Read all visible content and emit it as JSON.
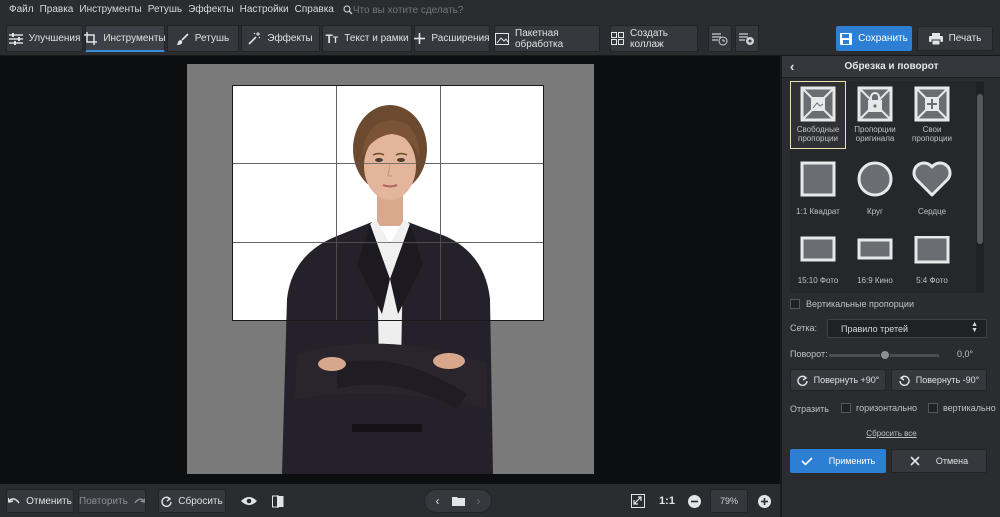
{
  "menu": {
    "items": [
      "Файл",
      "Правка",
      "Инструменты",
      "Ретушь",
      "Эффекты",
      "Настройки",
      "Справка"
    ],
    "search_placeholder": "Что вы хотите сделать?"
  },
  "toolbar": {
    "tabs": [
      {
        "label": "Улучшения",
        "icon": "sliders-icon"
      },
      {
        "label": "Инструменты",
        "icon": "crop-icon",
        "active": true
      },
      {
        "label": "Ретушь",
        "icon": "brush-icon"
      },
      {
        "label": "Эффекты",
        "icon": "magic-wand-icon"
      },
      {
        "label": "Текст и рамки",
        "icon": "text-icon"
      },
      {
        "label": "Расширения",
        "icon": "plus-icon"
      },
      {
        "label": "Пакетная обработка",
        "icon": "image-stack-icon"
      },
      {
        "label": "Создать коллаж",
        "icon": "collage-icon"
      }
    ],
    "save_label": "Сохранить",
    "print_label": "Печать"
  },
  "bottom": {
    "undo_label": "Отменить",
    "redo_label": "Повторить",
    "reset_label": "Сбросить",
    "one_to_one": "1:1",
    "zoom": "79%"
  },
  "panel": {
    "title": "Обрезка и поворот",
    "presets": [
      {
        "label": "Свободные пропорции",
        "selected": true
      },
      {
        "label": "Пропорции оригинала"
      },
      {
        "label": "Свои пропорции"
      },
      {
        "label": "1:1 Квадрат"
      },
      {
        "label": "Круг"
      },
      {
        "label": "Сердце"
      },
      {
        "label": "15:10 Фото"
      },
      {
        "label": "16:9 Кино"
      },
      {
        "label": "5:4 Фото"
      }
    ],
    "vertical_label": "Вертикальные пропорции",
    "grid_label": "Сетка:",
    "grid_value": "Правило третей",
    "rotation_label": "Поворот:",
    "rotation_value": "0,0°",
    "rotate_plus_label": "Повернуть +90°",
    "rotate_minus_label": "Повернуть -90°",
    "flip_label": "Отразить",
    "flip_h_label": "горизонтально",
    "flip_v_label": "вертикально",
    "reset_all_label": "Сбросить все",
    "apply_label": "Применить",
    "cancel_label": "Отмена"
  },
  "colors": {
    "accent": "#2d7fd3",
    "panel_bg": "#2a2c30",
    "canvas_bg": "#0d0e10"
  }
}
